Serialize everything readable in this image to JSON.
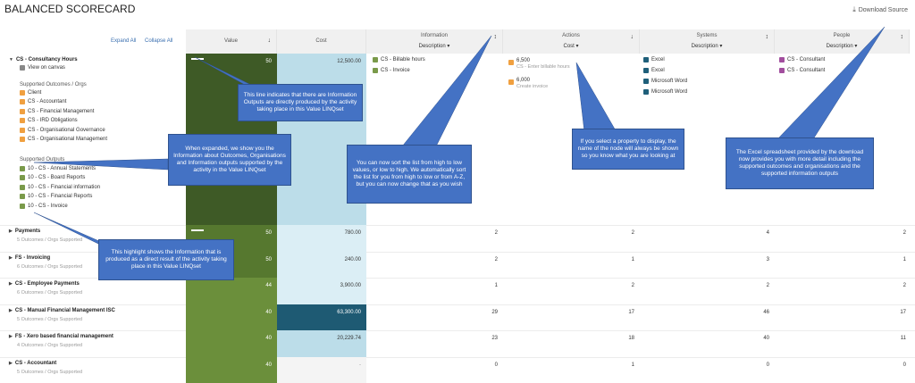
{
  "title": "BALANCED SCORECARD",
  "download_label": "Download Source",
  "links": {
    "expand": "Expand All",
    "collapse": "Collapse All"
  },
  "columns": {
    "value": "Value",
    "cost": "Cost",
    "information": {
      "title": "Information",
      "sub": "Description"
    },
    "actions": {
      "title": "Actions",
      "sub": "Cost"
    },
    "systems": {
      "title": "Systems",
      "sub": "Description"
    },
    "people": {
      "title": "People",
      "sub": "Description"
    }
  },
  "expanded": {
    "name": "CS - Consultancy Hours",
    "view": "View on canvas",
    "value": "50",
    "cost": "12,500.00",
    "outcomes_title": "Supported Outcomes / Orgs",
    "outcomes": [
      "Client",
      "CS - Accountant",
      "CS - Financial Management",
      "CS - IRD Obligations",
      "CS - Organisational Governance",
      "CS - Organisational Management"
    ],
    "outputs_title": "Supported Outputs",
    "outputs": [
      "10 - CS - Annual Statements",
      "10 - CS - Board Reports",
      "10 - CS - Financial information",
      "10 - CS - Financial Reports",
      "10 - CS - Invoice"
    ],
    "information": [
      "CS - Billable hours",
      "CS - Invoice"
    ],
    "actions": [
      {
        "cost": "6,500",
        "desc": "CS - Enter billable hours"
      },
      {
        "cost": "6,000",
        "desc": "Create invoice"
      }
    ],
    "systems": [
      "Excel",
      "Excel",
      "Microsoft Word",
      "Microsoft Word"
    ],
    "people": [
      "CS - Consultant",
      "CS - Consultant"
    ]
  },
  "rows": [
    {
      "name": "Payments",
      "sub": "5 Outcomes / Orgs Supported",
      "value": "50",
      "cost": "780.00",
      "info": "2",
      "actions": "2",
      "systems": "4",
      "people": "2"
    },
    {
      "name": "FS - Invoicing",
      "sub": "6 Outcomes / Orgs Supported",
      "value": "50",
      "cost": "240.00",
      "info": "2",
      "actions": "1",
      "systems": "3",
      "people": "1"
    },
    {
      "name": "CS - Employee Payments",
      "sub": "6 Outcomes / Orgs Supported",
      "value": "44",
      "cost": "3,900.00",
      "info": "1",
      "actions": "2",
      "systems": "2",
      "people": "2"
    },
    {
      "name": "CS - Manual Financial Management ISC",
      "sub": "5 Outcomes / Orgs Supported",
      "value": "40",
      "cost": "63,300.00",
      "info": "29",
      "actions": "17",
      "systems": "46",
      "people": "17"
    },
    {
      "name": "FS - Xero based financial management",
      "sub": "4 Outcomes / Orgs Supported",
      "value": "40",
      "cost": "20,229.74",
      "info": "23",
      "actions": "18",
      "systems": "40",
      "people": "11"
    },
    {
      "name": "CS - Accountant",
      "sub": "5 Outcomes / Orgs Supported",
      "value": "40",
      "cost": "-",
      "info": "0",
      "actions": "1",
      "systems": "0",
      "people": "0"
    }
  ],
  "callouts": {
    "c1": "This line indicates that there are Information Outputs are directly produced by the activity taking place in this Value LINQset",
    "c2": "When expanded, we show you the Information about Outcomes, Organisations and Information outputs supported by the activity in the Value LINQset",
    "c3": "You can now sort the list from high to low values, or low to high. We automatically sort the list for you from high to low or from A-Z, but you can now change that as you wish",
    "c4": "If you select a property to display, the name of the node will always be shown so you know what you are looking at",
    "c5": "The Excel spreadsheet provided by the download now provides you with more detail including the supported outcomes and organisations and the supported information outputs",
    "c6": "This highlight shows the Information that is produced as a direct result of the activity taking place in this Value LINQset"
  },
  "colors": {
    "value_dark": "#3e5a26",
    "value_mid": "#56782f",
    "value_light": "#6b8f3b",
    "cost_light": "#bcdde9",
    "cost_pale": "#dbeef5",
    "cost_dark": "#1e5a73",
    "info_sq": "#7a9a4a",
    "action_sq": "#f0a040",
    "system_sq": "#1f5f7a",
    "people_sq": "#a24e9e",
    "callout": "#4472c4"
  }
}
